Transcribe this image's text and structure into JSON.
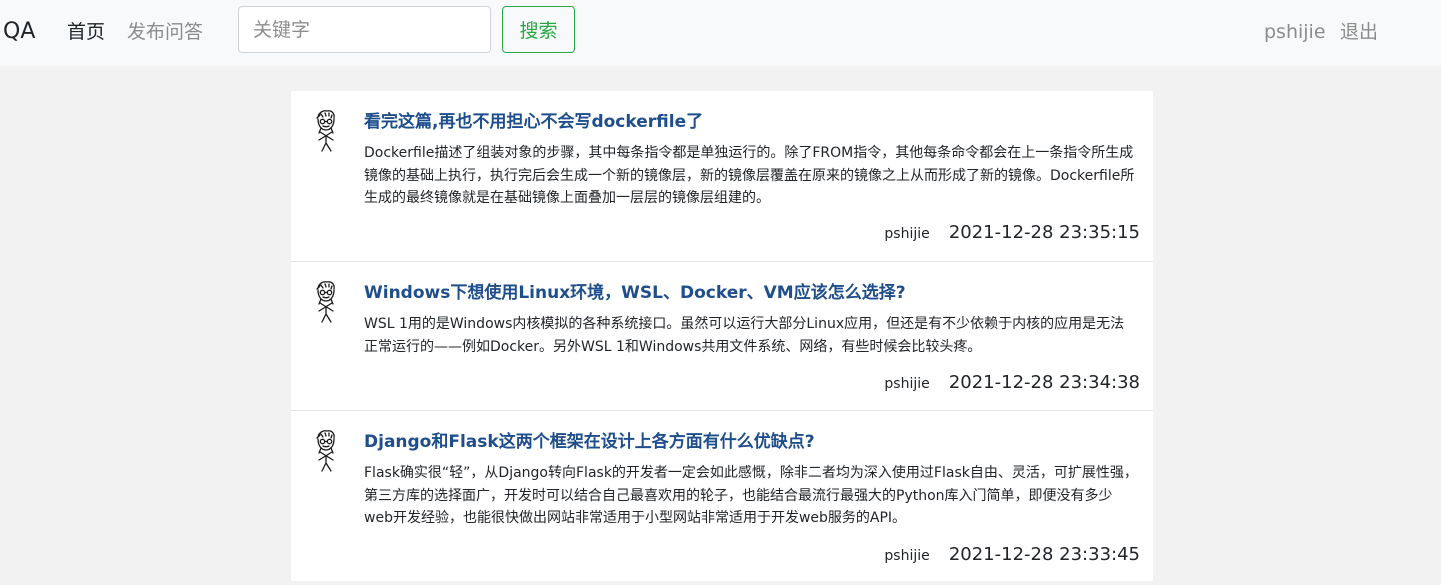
{
  "navbar": {
    "brand": "QA",
    "home": "首页",
    "publish": "发布问答",
    "search_placeholder": "关键字",
    "search_button": "搜索",
    "username": "pshijie",
    "logout": "退出"
  },
  "questions": [
    {
      "title": "看完这篇,再也不用担心不会写dockerfile了",
      "description": "Dockerfile描述了组装对象的步骤，其中每条指令都是单独运行的。除了FROM指令，其他每条命令都会在上一条指令所生成镜像的基础上执行，执行完后会生成一个新的镜像层，新的镜像层覆盖在原来的镜像之上从而形成了新的镜像。Dockerfile所生成的最终镜像就是在基础镜像上面叠加一层层的镜像层组建的。",
      "author": "pshijie",
      "time": "2021-12-28 23:35:15"
    },
    {
      "title": "Windows下想使用Linux环境，WSL、Docker、VM应该怎么选择?",
      "description": "WSL 1用的是Windows内核模拟的各种系统接口。虽然可以运行大部分Linux应用，但还是有不少依赖于内核的应用是无法正常运行的——例如Docker。另外WSL 1和Windows共用文件系统、网络，有些时候会比较头疼。",
      "author": "pshijie",
      "time": "2021-12-28 23:34:38"
    },
    {
      "title": "Django和Flask这两个框架在设计上各方面有什么优缺点?",
      "description": "Flask确实很“轻”，从Django转向Flask的开发者一定会如此感慨，除非二者均为深入使用过Flask自由、灵活，可扩展性强，第三方库的选择面广，开发时可以结合自己最喜欢用的轮子，也能结合最流行最强大的Python库入门简单，即便没有多少web开发经验，也能很快做出网站非常适用于小型网站非常适用于开发web服务的API。",
      "author": "pshijie",
      "time": "2021-12-28 23:33:45"
    }
  ]
}
